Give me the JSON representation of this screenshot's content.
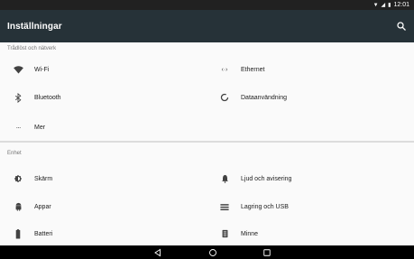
{
  "status_bar": {
    "time": "12:01"
  },
  "app_bar": {
    "title": "Inställningar"
  },
  "sections": [
    {
      "header": "Trådlöst och nätverk",
      "items": [
        {
          "label": "Wi-Fi",
          "icon": "wifi-icon"
        },
        {
          "label": "Ethernet",
          "icon": "ethernet-icon"
        },
        {
          "label": "Bluetooth",
          "icon": "bluetooth-icon"
        },
        {
          "label": "Dataanvändning",
          "icon": "data-usage-icon"
        },
        {
          "label": "Mer",
          "icon": "more-icon"
        }
      ]
    },
    {
      "header": "Enhet",
      "items": [
        {
          "label": "Skärm",
          "icon": "brightness-icon"
        },
        {
          "label": "Ljud och avisering",
          "icon": "bell-icon"
        },
        {
          "label": "Appar",
          "icon": "android-icon"
        },
        {
          "label": "Lagring och USB",
          "icon": "storage-icon"
        },
        {
          "label": "Batteri",
          "icon": "battery-icon"
        },
        {
          "label": "Minne",
          "icon": "memory-icon"
        }
      ]
    }
  ],
  "colors": {
    "app_bar": "#263238",
    "status_bar": "#212121",
    "background": "#fafafa",
    "icon": "#424242"
  }
}
